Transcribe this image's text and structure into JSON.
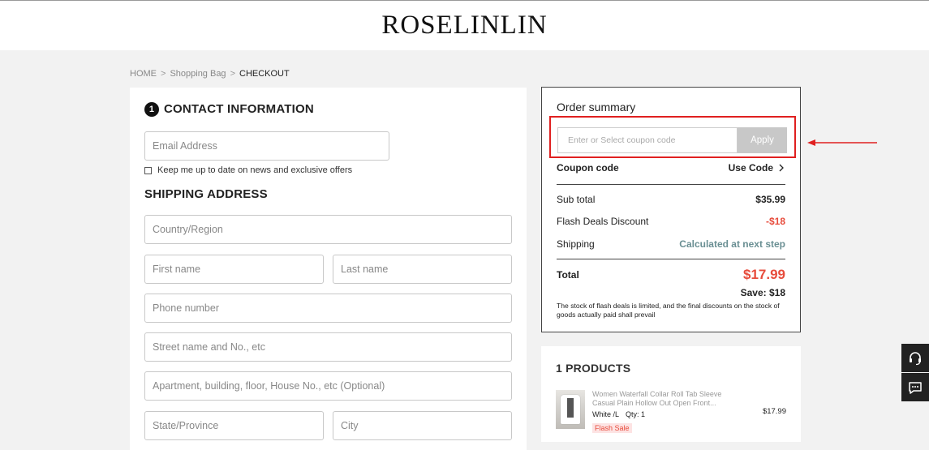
{
  "brand": {
    "logo": "ROSELINLIN"
  },
  "breadcrumb": {
    "home": "HOME",
    "bag": "Shopping Bag",
    "current": "CHECKOUT",
    "separator": ">"
  },
  "contact": {
    "step": "1",
    "title": "CONTACT INFORMATION",
    "email_placeholder": "Email Address",
    "newsletter_label": "Keep me up to date on news and exclusive offers"
  },
  "shipping": {
    "title": "SHIPPING ADDRESS",
    "country_placeholder": "Country/Region",
    "first_name_placeholder": "First name",
    "last_name_placeholder": "Last name",
    "phone_placeholder": "Phone number",
    "street_placeholder": "Street name and No., etc",
    "apartment_placeholder": "Apartment, building, floor, House No., etc (Optional)",
    "state_placeholder": "State/Province",
    "city_placeholder": "City"
  },
  "summary": {
    "title": "Order summary",
    "coupon_placeholder": "Enter or Select coupon code",
    "apply_label": "Apply",
    "coupon_label": "Coupon code",
    "use_code_label": "Use Code",
    "subtotal_label": "Sub total",
    "subtotal_value": "$35.99",
    "discount_label": "Flash Deals Discount",
    "discount_value": "-$18",
    "shipping_label": "Shipping",
    "shipping_value": "Calculated at next step",
    "total_label": "Total",
    "total_value": "$17.99",
    "save_text": "Save: $18",
    "note": "The stock of flash deals is limited, and the final discounts on the stock of goods actually paid shall prevail"
  },
  "products": {
    "title": "1 PRODUCTS",
    "items": [
      {
        "name": "Women Waterfall Collar Roll Tab Sleeve Casual Plain Hollow Out Open Front...",
        "variant": "White /L",
        "qty": "Qty: 1",
        "tag": "Flash Sale",
        "price": "$17.99"
      }
    ]
  },
  "colors": {
    "accent_red": "#e74c3c",
    "highlight_border": "#e02020",
    "teal": "#6a8f93"
  },
  "icons": {
    "support": "headset-icon",
    "chat": "chat-icon",
    "chevron": "chevron-right-icon",
    "annotation": "arrow-left-icon"
  }
}
